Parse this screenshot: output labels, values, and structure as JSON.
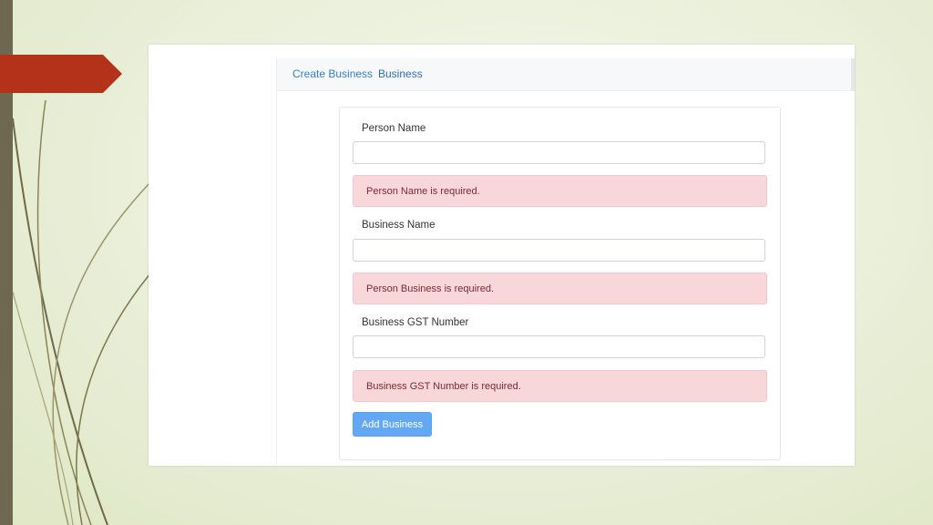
{
  "nav": {
    "create_business": "Create Business",
    "business": "Business"
  },
  "form": {
    "person_name_label": "Person Name",
    "person_name_value": "",
    "person_name_error": "Person Name is required.",
    "business_name_label": "Business Name",
    "business_name_value": "",
    "business_name_error": "Person Business is required.",
    "gst_label": "Business GST Number",
    "gst_value": "",
    "gst_error": "Business GST Number is required.",
    "submit_label": "Add Business"
  },
  "colors": {
    "slide_background": "#e9efd8",
    "accent_arrow": "#b5321a",
    "left_bar": "#6e6850",
    "link": "#2f7fd1",
    "alert_bg": "#f7d7da",
    "alert_text": "#7a2a30",
    "button_bg": "#62a8f4"
  }
}
